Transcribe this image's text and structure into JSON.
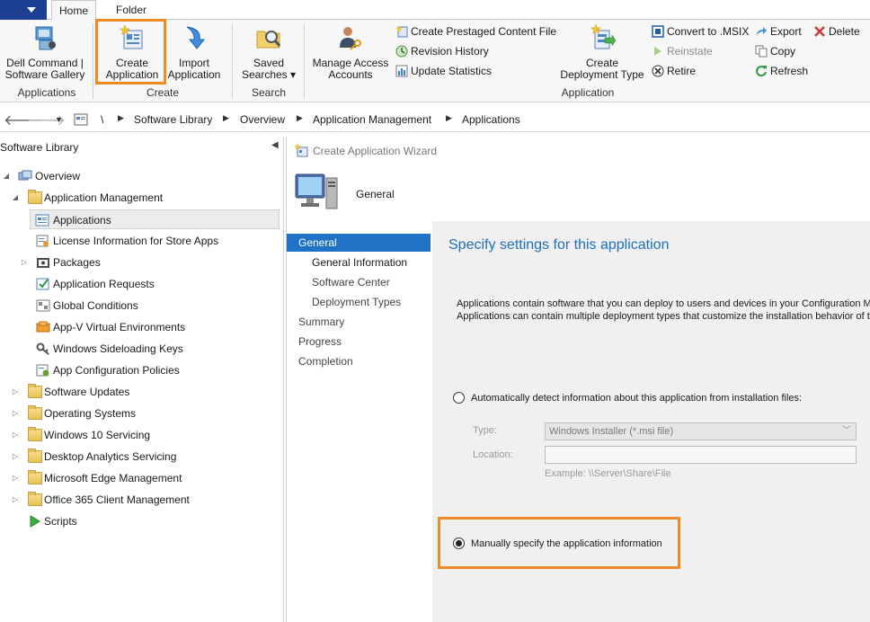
{
  "ribbon": {
    "tabs": [
      "Home",
      "Folder"
    ],
    "groups": {
      "applications": {
        "label": "Applications",
        "dell": {
          "line1": "Dell Command |",
          "line2": "Software Gallery"
        }
      },
      "create": {
        "label": "Create",
        "create_app": {
          "line1": "Create",
          "line2": "Application"
        },
        "import_app": {
          "line1": "Import",
          "line2": "Application"
        }
      },
      "search": {
        "label": "Search",
        "saved": {
          "line1": "Saved",
          "line2": "Searches ▾"
        }
      },
      "application": {
        "label": "Application",
        "manage": {
          "line1": "Manage Access",
          "line2": "Accounts"
        },
        "prestaged": "Create Prestaged Content File",
        "revision": "Revision History",
        "update_stats": "Update Statistics",
        "create_dt": {
          "line1": "Create",
          "line2": "Deployment Type"
        },
        "convert": "Convert to .MSIX",
        "reinstate": "Reinstate",
        "retire": "Retire",
        "export": "Export",
        "copy": "Copy",
        "refresh": "Refresh",
        "delete": "Delete"
      }
    }
  },
  "breadcrumb": [
    "\\",
    "Software Library",
    "Overview",
    "Application Management",
    "Applications"
  ],
  "nav": {
    "title": "Software Library",
    "items": [
      {
        "label": "Overview"
      },
      {
        "label": "Application Management"
      },
      {
        "label": "Applications"
      },
      {
        "label": "License Information for Store Apps"
      },
      {
        "label": "Packages"
      },
      {
        "label": "Application Requests"
      },
      {
        "label": "Global Conditions"
      },
      {
        "label": "App-V Virtual Environments"
      },
      {
        "label": "Windows Sideloading Keys"
      },
      {
        "label": "App Configuration Policies"
      },
      {
        "label": "Software Updates"
      },
      {
        "label": "Operating Systems"
      },
      {
        "label": "Windows 10 Servicing"
      },
      {
        "label": "Desktop Analytics Servicing"
      },
      {
        "label": "Microsoft Edge Management"
      },
      {
        "label": "Office 365 Client Management"
      },
      {
        "label": "Scripts"
      }
    ]
  },
  "wizard": {
    "title": "Create Application Wizard",
    "header": "General",
    "steps": [
      "General",
      "General Information",
      "Software Center",
      "Deployment Types",
      "Summary",
      "Progress",
      "Completion"
    ],
    "heading": "Specify settings for this application",
    "desc1": "Applications contain software that you can deploy to users and devices in your Configuration Mana",
    "desc2": "Applications can contain multiple deployment types that customize the installation behavior of the a",
    "auto_label": "Automatically detect information about this application from installation files:",
    "type_label": "Type:",
    "type_value": "Windows Installer (*.msi file)",
    "location_label": "Location:",
    "location_value": "",
    "example": "Example: \\\\Server\\Share\\File",
    "manual_label": "Manually specify the application information"
  },
  "colors": {
    "accent": "#1f72c6",
    "highlight": "#f08a24",
    "app_button": "#1c3f91"
  }
}
